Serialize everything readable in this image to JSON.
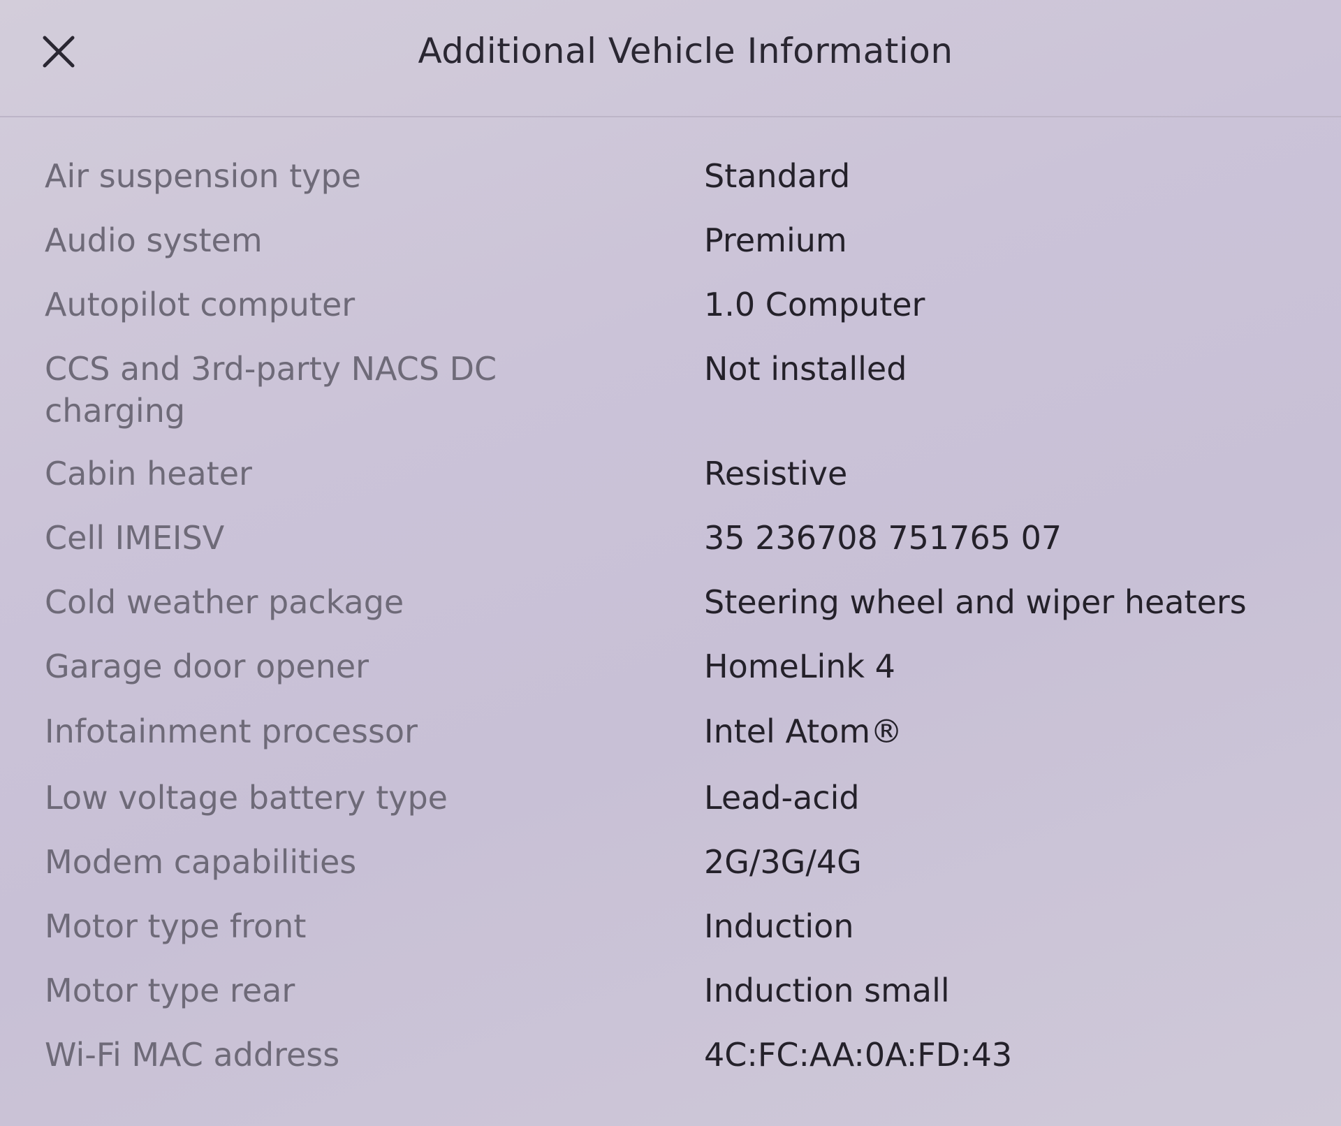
{
  "header": {
    "title": "Additional Vehicle Information",
    "close_icon": "close-icon"
  },
  "rows": [
    {
      "label": "Air suspension type",
      "value": "Standard"
    },
    {
      "label": "Audio system",
      "value": "Premium"
    },
    {
      "label": "Autopilot computer",
      "value": "1.0 Computer"
    },
    {
      "label": "CCS and 3rd-party NACS DC charging",
      "value": "Not installed"
    },
    {
      "label": "Cabin heater",
      "value": "Resistive"
    },
    {
      "label": "Cell IMEISV",
      "value": "35 236708 751765 07"
    },
    {
      "label": "Cold weather package",
      "value": "Steering wheel and wiper heaters"
    },
    {
      "label": "Garage door opener",
      "value": "HomeLink 4"
    },
    {
      "label": "Infotainment processor",
      "value": "Intel Atom®"
    },
    {
      "label": "Low voltage battery type",
      "value": "Lead-acid"
    },
    {
      "label": "Modem capabilities",
      "value": "2G/3G/4G"
    },
    {
      "label": "Motor type front",
      "value": "Induction"
    },
    {
      "label": "Motor type rear",
      "value": "Induction small"
    },
    {
      "label": "Wi-Fi MAC address",
      "value": "4C:FC:AA:0A:FD:43"
    }
  ]
}
